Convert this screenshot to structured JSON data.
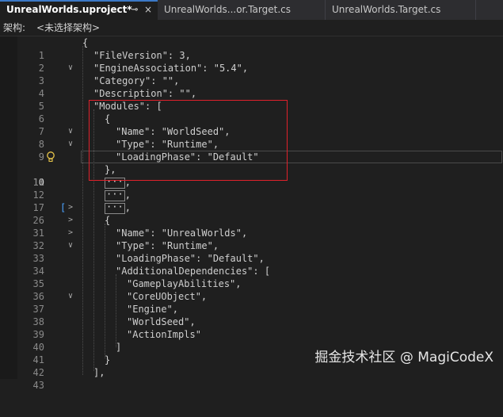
{
  "tabs": [
    {
      "label": "UnrealWorlds.uproject*",
      "active": true
    },
    {
      "label": "UnrealWorlds...or.Target.cs",
      "active": false
    },
    {
      "label": "UnrealWorlds.Target.cs",
      "active": false
    }
  ],
  "tab_pin_glyph": "⊸",
  "tab_close_glyph": "×",
  "schema": {
    "label": "架构:",
    "value": "<未选择架构>"
  },
  "lines": [
    {
      "n": "1",
      "text": "{"
    },
    {
      "n": "2",
      "text": "\"FileVersion\": 3,"
    },
    {
      "n": "3",
      "text": "\"EngineAssociation\": \"5.4\","
    },
    {
      "n": "4",
      "text": "\"Category\": \"\","
    },
    {
      "n": "5",
      "text": "\"Description\": \"\","
    },
    {
      "n": "6",
      "text": "\"Modules\": ["
    },
    {
      "n": "7",
      "text": "{"
    },
    {
      "n": "8",
      "text": "\"Name\": \"WorldSeed\","
    },
    {
      "n": "9",
      "text": "\"Type\": \"Runtime\","
    },
    {
      "n": "10",
      "text": "\"LoadingPhase\": \"Default\""
    },
    {
      "n": "11",
      "text": "},"
    },
    {
      "n": "12",
      "text": ","
    },
    {
      "n": "17",
      "text": ","
    },
    {
      "n": "26",
      "text": ","
    },
    {
      "n": "31",
      "text": "{"
    },
    {
      "n": "32",
      "text": "\"Name\": \"UnrealWorlds\","
    },
    {
      "n": "33",
      "text": "\"Type\": \"Runtime\","
    },
    {
      "n": "34",
      "text": "\"LoadingPhase\": \"Default\","
    },
    {
      "n": "35",
      "text": "\"AdditionalDependencies\": ["
    },
    {
      "n": "36",
      "text": "\"GameplayAbilities\","
    },
    {
      "n": "37",
      "text": "\"CoreUObject\","
    },
    {
      "n": "38",
      "text": "\"Engine\","
    },
    {
      "n": "39",
      "text": "\"WorldSeed\","
    },
    {
      "n": "40",
      "text": "\"ActionImpls\""
    },
    {
      "n": "41",
      "text": "]"
    },
    {
      "n": "42",
      "text": "}"
    },
    {
      "n": "43",
      "text": "],"
    }
  ],
  "collapsed_marker": "···",
  "fold_glyphs": {
    "open": "∨",
    "closed": ">"
  },
  "cursor_line": "10",
  "watermark": "掘金技术社区 @ MagiCodeX",
  "colors": {
    "accent": "#3b78c6",
    "highlight_box": "#e0212b",
    "background": "#1f1f1f"
  }
}
